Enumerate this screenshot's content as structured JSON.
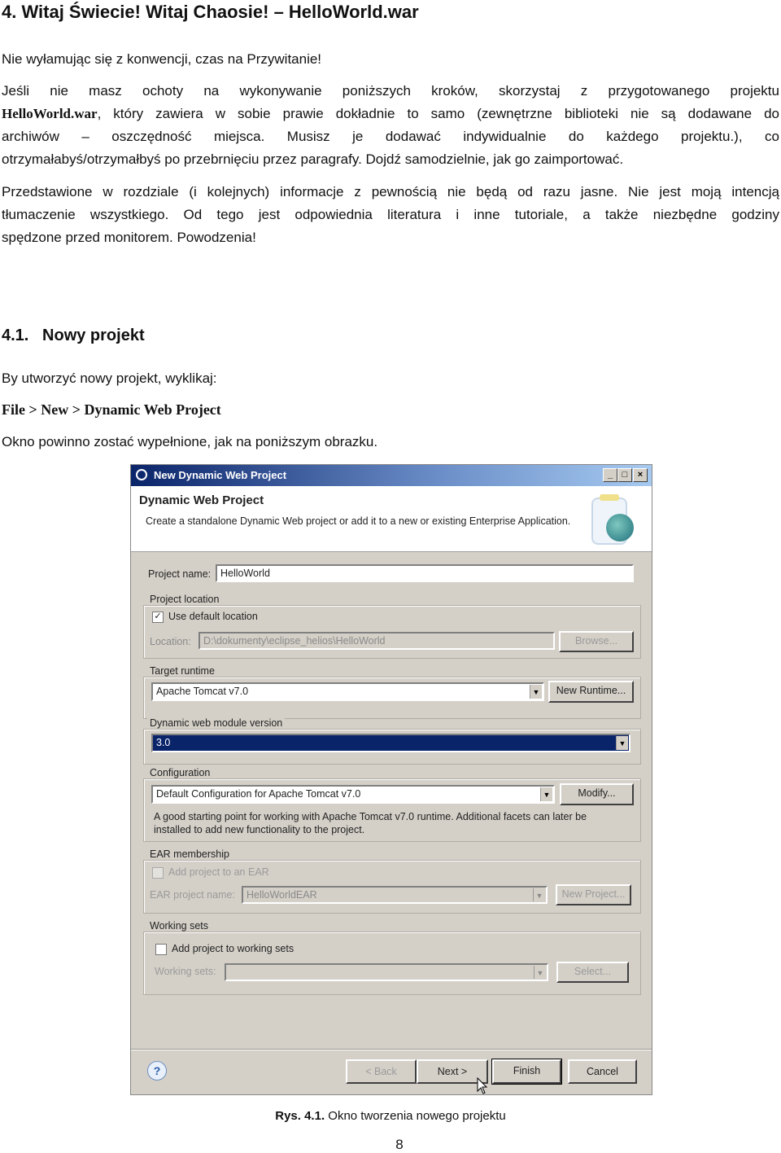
{
  "heading": "4.   Witaj Świecie! Witaj Chaosie! – HelloWorld.war",
  "intro": "Nie wyłamując się z konwencji, czas na Przywitanie!",
  "para2": {
    "l1": "Jeśli nie masz ochoty na wykonywanie poniższych kroków, skorzystaj z przygotowanego projektu",
    "l2_bold": "HelloWorld.war",
    "l2": ", który zawiera w sobie prawie dokładnie to samo (zewnętrzne biblioteki nie są dodawane do",
    "l3": "archiwów – oszczędność miejsca. Musisz je dodawać indywidualnie do każdego projektu.), co",
    "l4": "otrzymałabyś/otrzymałbyś po przebrnięciu przez paragrafy. Dojdź samodzielnie, jak go zaimportować."
  },
  "para3": {
    "l1": "Przedstawione w rozdziale (i kolejnych) informacje z pewnością nie będą od razu jasne. Nie jest moją intencją",
    "l2": "tłumaczenie wszystkiego. Od tego jest odpowiednia literatura i inne tutoriale, a także niezbędne godziny",
    "l3": "spędzone przed monitorem. Powodzenia!"
  },
  "section": {
    "number": "4.1.",
    "title": "Nowy projekt"
  },
  "instruction": "By utworzyć nowy projekt, wyklikaj:",
  "menu_path": "File > New > Dynamic Web Project",
  "note": "Okno powinno zostać wypełnione, jak na poniższym obrazku.",
  "dialog": {
    "window_title": "New Dynamic Web Project",
    "header_title": "Dynamic Web Project",
    "header_desc": "Create a standalone Dynamic Web project or add it to a new or existing Enterprise Application.",
    "project_name_label": "Project name:",
    "project_name": "HelloWorld",
    "location_group": "Project location",
    "use_default_label": "Use default location",
    "use_default_checked": true,
    "location_label": "Location:",
    "location_value": "D:\\dokumenty\\eclipse_helios\\HelloWorld",
    "browse": "Browse...",
    "runtime_group": "Target runtime",
    "runtime_value": "Apache Tomcat v7.0",
    "new_runtime": "New Runtime...",
    "module_group": "Dynamic web module version",
    "module_value": "3.0",
    "config_group": "Configuration",
    "config_value": "Default Configuration for Apache Tomcat v7.0",
    "modify": "Modify...",
    "config_desc1": "A good starting point for working with Apache Tomcat v7.0 runtime. Additional facets can later be",
    "config_desc2": "installed to add new functionality to the project.",
    "ear_group": "EAR membership",
    "ear_add_label": "Add project to an EAR",
    "ear_add_checked": false,
    "ear_name_label": "EAR project name:",
    "ear_name_value": "HelloWorldEAR",
    "new_project": "New Project...",
    "ws_group": "Working sets",
    "ws_add_label": "Add project to working sets",
    "ws_add_checked": false,
    "ws_label": "Working sets:",
    "select": "Select...",
    "back": "< Back",
    "next": "Next >",
    "finish": "Finish",
    "cancel": "Cancel",
    "colors": {
      "titlebar": "#0a246a",
      "selection": "#0a246a",
      "dialog_bg": "#d4d0c8"
    }
  },
  "caption": {
    "label": "Rys. 4.1.",
    "text": " Okno tworzenia nowego projektu"
  },
  "page_number": "8"
}
